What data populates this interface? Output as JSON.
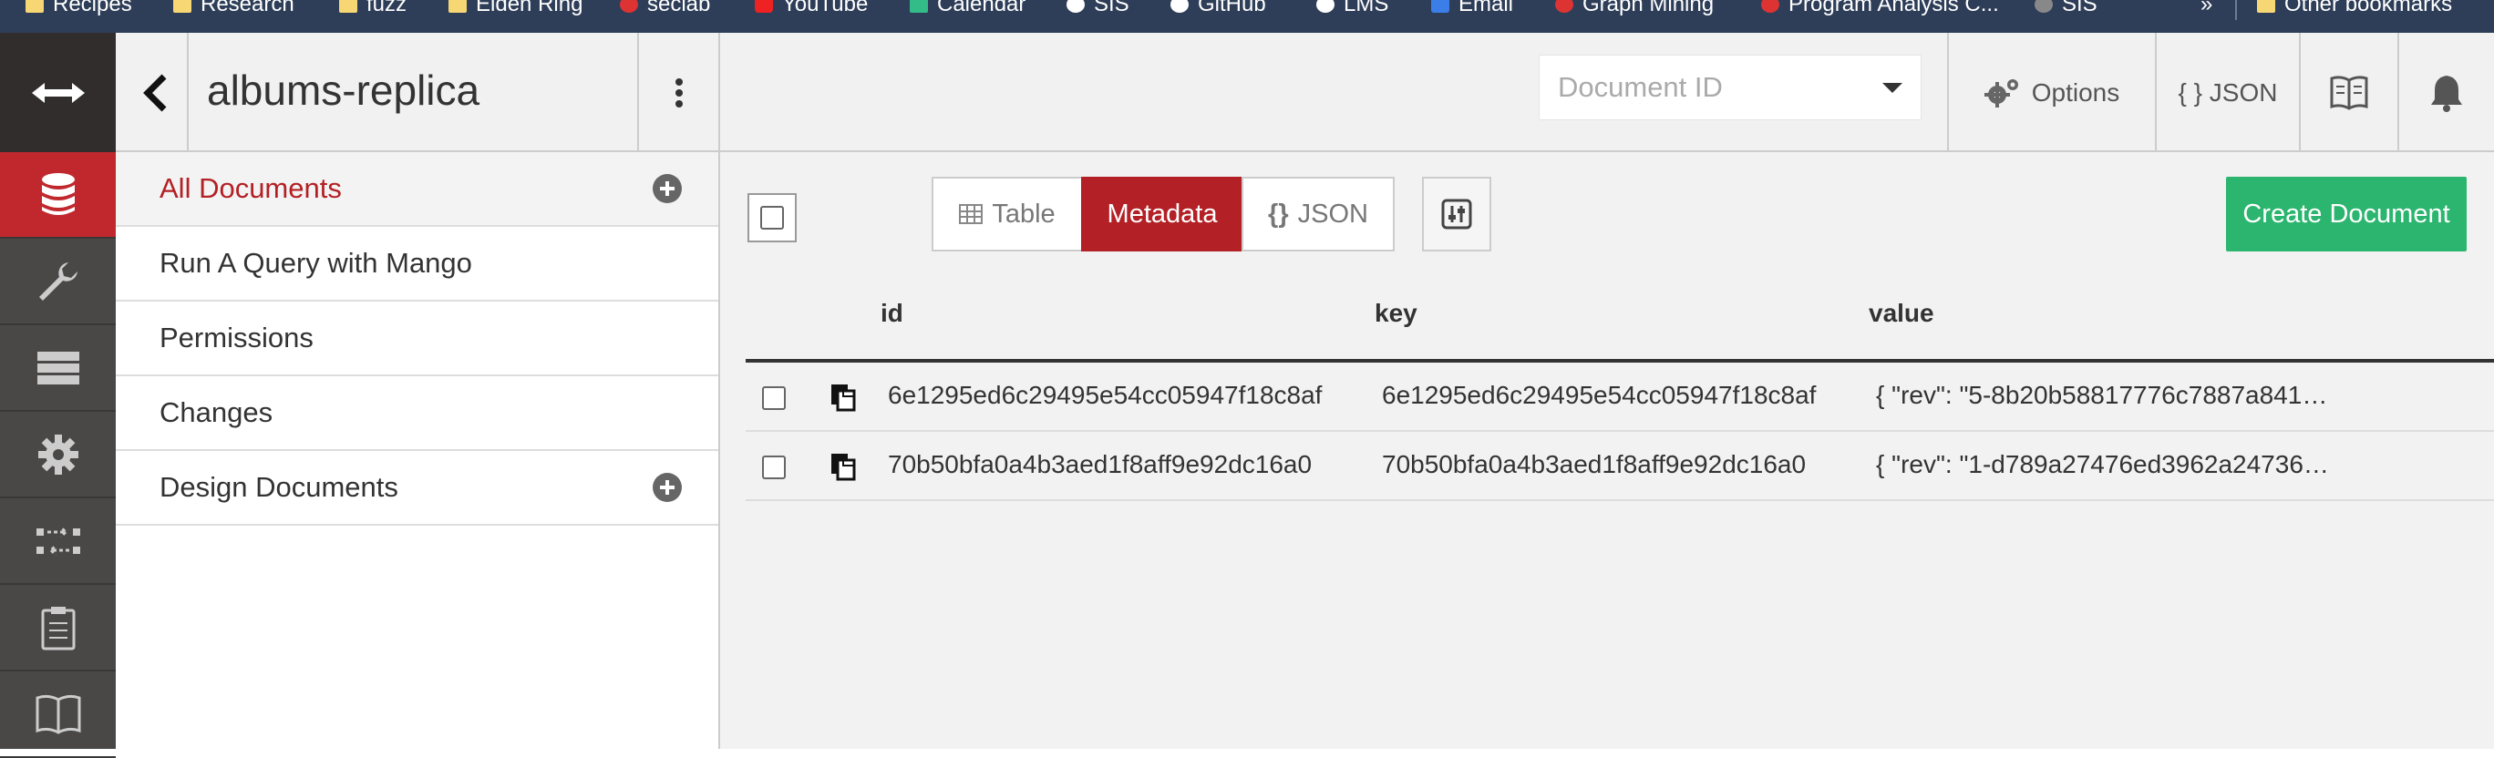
{
  "bookmarks": [
    {
      "label": "Recipes",
      "icon": "folder-icon"
    },
    {
      "label": "Research",
      "icon": "folder-icon"
    },
    {
      "label": "fuzz",
      "icon": "folder-icon"
    },
    {
      "label": "Elden Ring",
      "icon": "folder-icon"
    },
    {
      "label": "seclab",
      "icon": "seclab-icon"
    },
    {
      "label": "YouTube",
      "icon": "youtube-icon"
    },
    {
      "label": "Calendar",
      "icon": "calendar-icon"
    },
    {
      "label": "SIS",
      "icon": "sis-icon"
    },
    {
      "label": "GitHub",
      "icon": "github-icon"
    },
    {
      "label": "LMS",
      "icon": "lms-icon"
    },
    {
      "label": "Email",
      "icon": "email-icon"
    },
    {
      "label": "Graph Mining",
      "icon": "graph-mining-icon"
    },
    {
      "label": "Program Analysis C...",
      "icon": "program-analysis-icon"
    },
    {
      "label": "SIS",
      "icon": "sis-icon"
    }
  ],
  "bookmarks_more": "»",
  "other_bookmarks": "Other bookmarks",
  "sidebar": {
    "db_name": "albums-replica",
    "items": [
      {
        "label": "All Documents",
        "active": true,
        "has_add": true
      },
      {
        "label": "Run A Query with Mango",
        "active": false,
        "has_add": false
      },
      {
        "label": "Permissions",
        "active": false,
        "has_add": false
      },
      {
        "label": "Changes",
        "active": false,
        "has_add": false
      },
      {
        "label": "Design Documents",
        "active": false,
        "has_add": true
      }
    ]
  },
  "topbar": {
    "doc_id_placeholder": "Document ID",
    "options_label": "Options",
    "json_label": "{ } JSON"
  },
  "toolbar": {
    "views": [
      {
        "label": "Table",
        "active": false
      },
      {
        "label": "Metadata",
        "active": true
      },
      {
        "label": "JSON",
        "active": false
      }
    ],
    "create_label": "Create Document"
  },
  "table": {
    "columns": [
      "id",
      "key",
      "value"
    ],
    "rows": [
      {
        "id": "6e1295ed6c29495e54cc05947f18c8af",
        "key": "6e1295ed6c29495e54cc05947f18c8af",
        "value": "{ \"rev\": \"5-8b20b58817776c7887a841…"
      },
      {
        "id": "70b50bfa0a4b3aed1f8aff9e92dc16a0",
        "key": "70b50bfa0a4b3aed1f8aff9e92dc16a0",
        "value": "{ \"rev\": \"1-d789a27476ed3962a24736…"
      }
    ]
  },
  "colors": {
    "accent": "#b32025",
    "create": "#2bb56e",
    "rail": "#4a4747",
    "bookmarks_bar": "#2e3e58"
  }
}
